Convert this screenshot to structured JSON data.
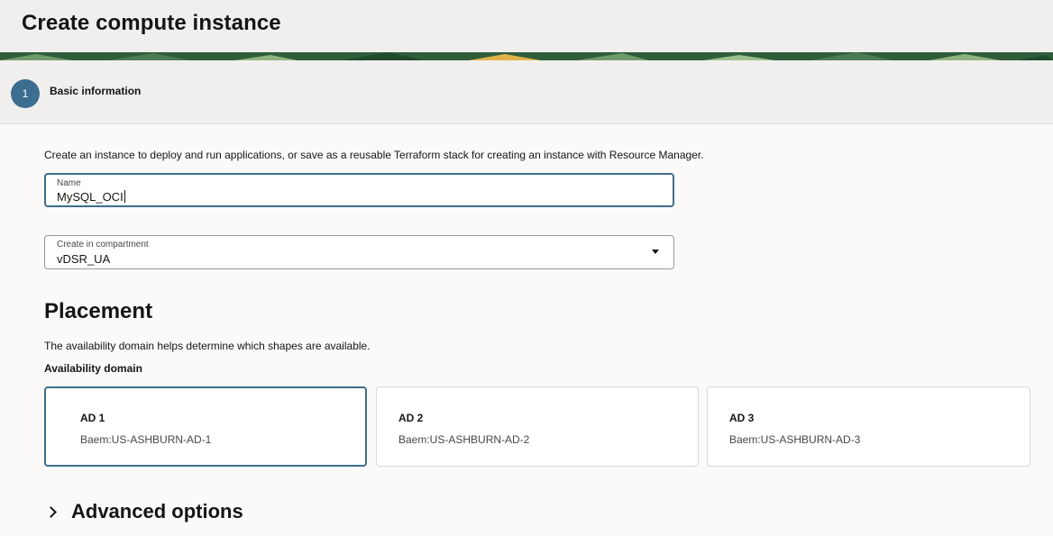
{
  "header": {
    "title": "Create compute instance"
  },
  "step": {
    "number": "1",
    "label": "Basic information"
  },
  "form": {
    "intro": "Create an instance to deploy and run applications, or save as a reusable Terraform stack for creating an instance with Resource Manager.",
    "name": {
      "label": "Name",
      "value": "MySQL_OCI"
    },
    "compartment": {
      "label": "Create in compartment",
      "value": "vDSR_UA"
    }
  },
  "placement": {
    "title": "Placement",
    "description": "The availability domain helps determine which shapes are available.",
    "domain_label": "Availability domain",
    "domains": [
      {
        "name": "AD 1",
        "value": "Baem:US-ASHBURN-AD-1",
        "selected": true
      },
      {
        "name": "AD 2",
        "value": "Baem:US-ASHBURN-AD-2",
        "selected": false
      },
      {
        "name": "AD 3",
        "value": "Baem:US-ASHBURN-AD-3",
        "selected": false
      }
    ]
  },
  "advanced": {
    "label": "Advanced options"
  },
  "colors": {
    "accent": "#3d6e8d",
    "step": "#3b6e8f",
    "banner": "#2f5d3a"
  },
  "icons": {
    "dropdown": "chevron-down-icon",
    "expand": "chevron-right-icon"
  }
}
